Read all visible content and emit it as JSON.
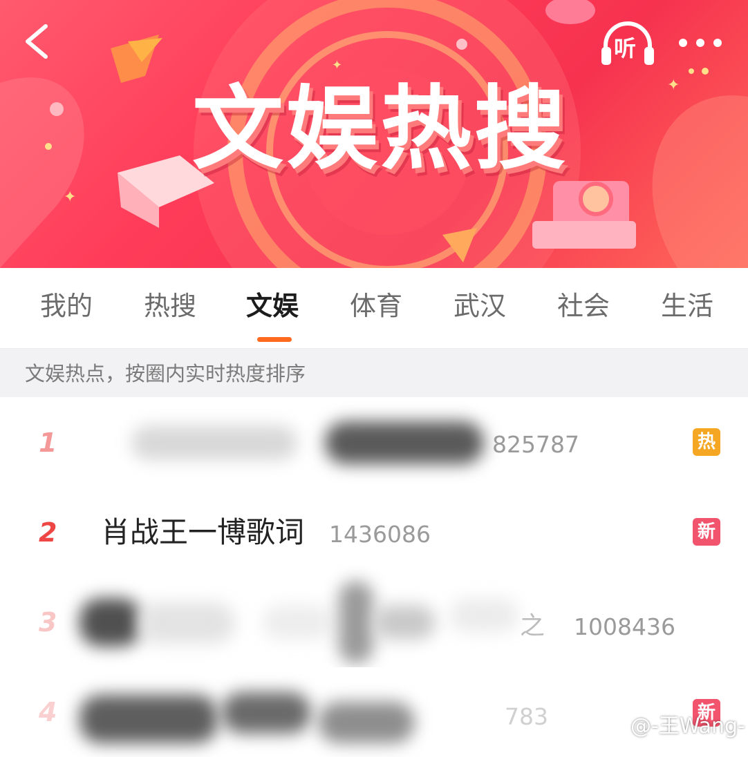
{
  "banner": {
    "title": "文娱热搜",
    "listen_label": "听"
  },
  "tabs": [
    {
      "label": "我的",
      "active": false
    },
    {
      "label": "热搜",
      "active": false
    },
    {
      "label": "文娱",
      "active": true
    },
    {
      "label": "体育",
      "active": false
    },
    {
      "label": "武汉",
      "active": false
    },
    {
      "label": "社会",
      "active": false
    },
    {
      "label": "生活",
      "active": false
    }
  ],
  "subtitle": "文娱热点，按圈内实时热度排序",
  "list": [
    {
      "rank": "1",
      "title": "",
      "count": "825787",
      "badge": "热",
      "badge_color": "#f5a623"
    },
    {
      "rank": "2",
      "title": "肖战王一博歌词",
      "count": "1436086",
      "badge": "新",
      "badge_color": "#f2546d"
    },
    {
      "rank": "3",
      "title": "之",
      "count": "1008436",
      "badge": "",
      "badge_color": ""
    },
    {
      "rank": "4",
      "title": "",
      "count": "783",
      "badge": "新",
      "badge_color": "#f2546d"
    }
  ],
  "watermark": "@-王Wang-",
  "colors": {
    "accent": "#ff6a1f",
    "rank": "#ee4545",
    "banner": "#f6324f"
  }
}
